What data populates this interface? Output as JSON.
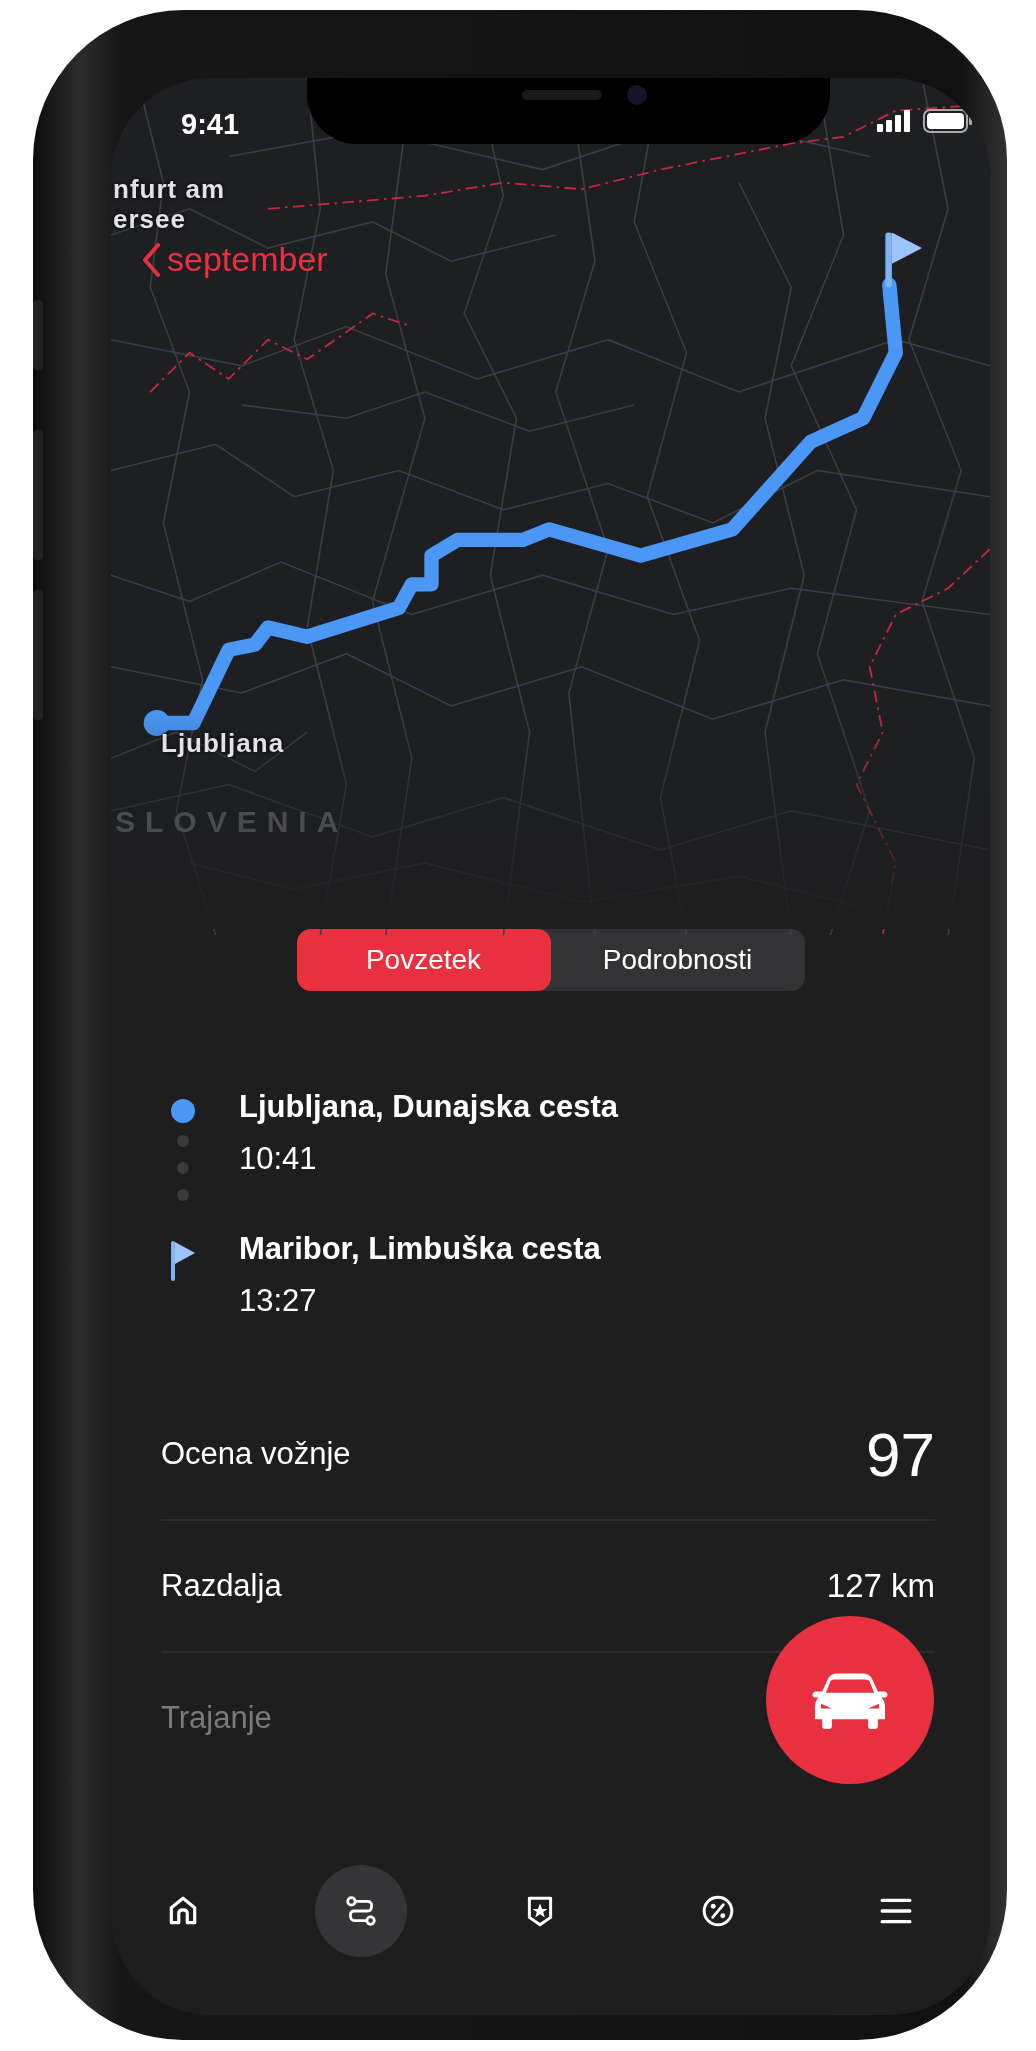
{
  "status_bar": {
    "time": "9:41"
  },
  "map": {
    "back_link": "september",
    "labels": [
      {
        "kind": "city",
        "text": "nfurt am"
      },
      {
        "kind": "city",
        "text": "ersee"
      },
      {
        "kind": "city",
        "text": "Ljubljana"
      },
      {
        "kind": "country",
        "text": "SLOVENIA"
      }
    ]
  },
  "tabs": [
    {
      "label": "Povzetek",
      "selected": true
    },
    {
      "label": "Podrobnosti",
      "selected": false
    }
  ],
  "stops": [
    {
      "kind": "start",
      "place": "Ljubljana, Dunajska cesta",
      "time": "10:41"
    },
    {
      "kind": "end",
      "place": "Maribor, Limbuška cesta",
      "time": "13:27"
    }
  ],
  "stats": [
    {
      "kind": "score",
      "label": "Ocena vožnje",
      "value": "97",
      "disabled": false
    },
    {
      "kind": "plain",
      "label": "Razdalja",
      "value": "127 km",
      "disabled": false
    },
    {
      "kind": "plain",
      "label": "Trajanje",
      "disabled": true
    }
  ],
  "nav": [
    {
      "kind": "home",
      "selected": false
    },
    {
      "kind": "route",
      "selected": true
    },
    {
      "kind": "badge",
      "selected": false
    },
    {
      "kind": "percent",
      "selected": false
    },
    {
      "kind": "menu",
      "selected": false
    }
  ]
}
